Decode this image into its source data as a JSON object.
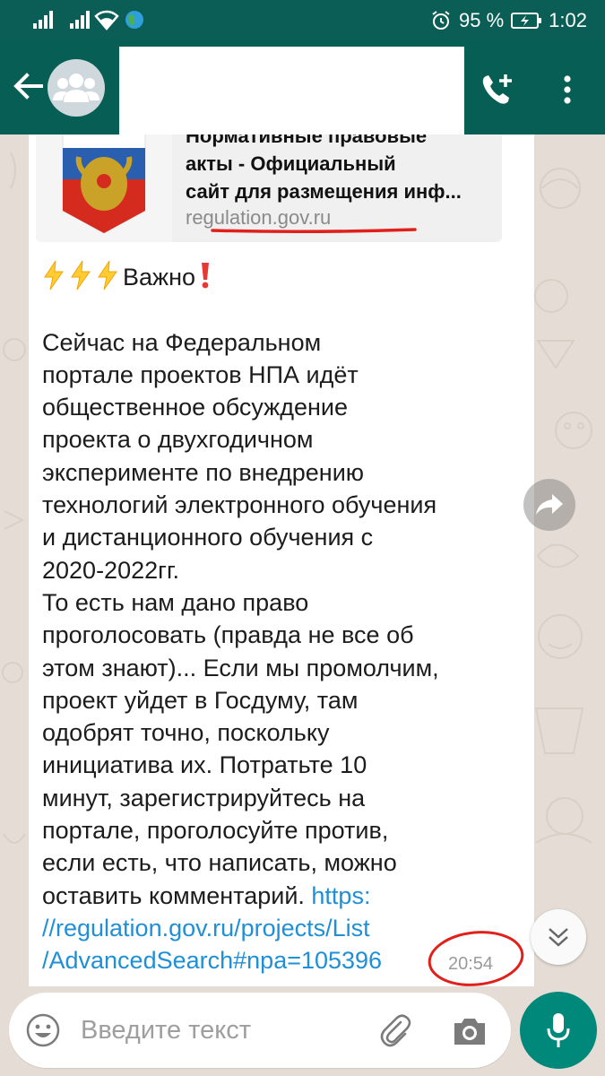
{
  "status_bar": {
    "battery": "95 %",
    "time": "1:02"
  },
  "colors": {
    "header": "#075e54",
    "status_bar": "#0b5e55",
    "chat_bg": "#e5ddd5",
    "bubble": "#ffffff",
    "link": "#1f8fd6",
    "annotation": "#e0201b",
    "fab": "#00897b"
  },
  "header": {
    "back_icon": "arrow-left-icon",
    "avatar_icon": "group-avatar-icon",
    "add_call_icon": "add-call-icon",
    "menu_icon": "more-vert-icon"
  },
  "message": {
    "preview_title": "Нормативные правовые\nакты - Официальный\nсайт для размещения инф...",
    "preview_domain": "regulation.gov.ru",
    "important_label": "Важно",
    "body": "Сейчас на Федеральном\nпортале проектов НПА идёт\nобщественное обсуждение\nпроекта о двухгодичном\nэксперименте по внедрению\nтехнологий электронного обучения\nи дистанционного обучения с\n2020-2022гг.\nТо есть нам дано право\nпроголосовать (правда не все об\nэтом знают)... Если мы промолчим,\nпроект уйдет в Госдуму, там\nодобрят точно, поскольку\nинициатива их. Потратьте 10\nминут, зарегистрируйтесь на\nпортале, проголосуйте против,\nесли есть, что написать, можно\nоставить комментарий. ",
    "link": "https:\n//regulation.gov.ru/projects/List\n/AdvancedSearch#npa=105396",
    "time": "20:54"
  },
  "input": {
    "placeholder": "Введите текст",
    "emoji_icon": "emoji-icon",
    "attach_icon": "paperclip-icon",
    "camera_icon": "camera-icon",
    "mic_icon": "mic-icon"
  }
}
